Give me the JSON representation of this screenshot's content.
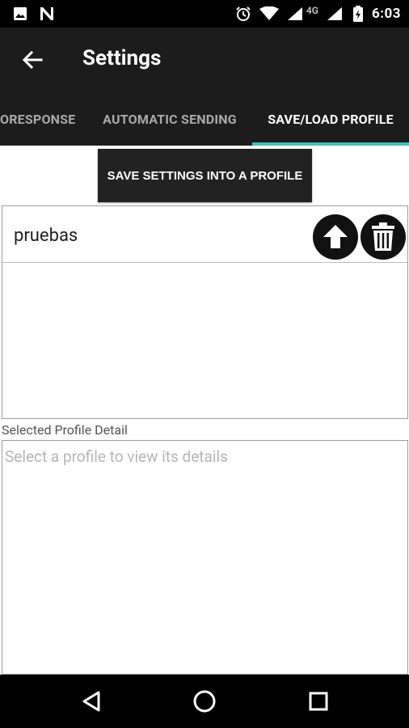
{
  "status_bar": {
    "time": "6:03",
    "network": "4G",
    "icons": [
      "image-icon",
      "n-notification-icon",
      "alarm-icon",
      "wifi-icon",
      "cell-signal-icon",
      "battery-charging-icon"
    ]
  },
  "app_bar": {
    "title": "Settings",
    "back_icon": "arrow-left-icon"
  },
  "tabs": [
    {
      "label": "ORESPONSE",
      "active": false
    },
    {
      "label": "AUTOMATIC SENDING",
      "active": false
    },
    {
      "label": "SAVE/LOAD PROFILE",
      "active": true
    }
  ],
  "colors": {
    "toolbar": "#1c1c1c",
    "tab_indicator": "#3dc1b2",
    "button": "#222222"
  },
  "save_button": {
    "label": "SAVE SETTINGS INTO A PROFILE"
  },
  "profiles": [
    {
      "name": "pruebas",
      "actions": [
        "upload-arrow-icon",
        "trash-icon"
      ]
    }
  ],
  "detail": {
    "label": "Selected Profile Detail",
    "placeholder": "Select a profile to view its details"
  },
  "nav_bar": {
    "icons": [
      "back-triangle-icon",
      "home-circle-icon",
      "recents-square-icon"
    ]
  }
}
